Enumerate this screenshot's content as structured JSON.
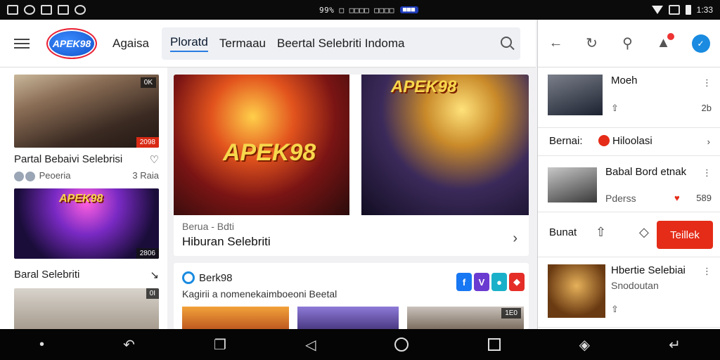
{
  "statusbar": {
    "mid_text": "99% □ □□□□ □□□□",
    "time": "1:33"
  },
  "appbar": {
    "logo_text": "APEK98",
    "home_label": "Agaisa",
    "tabs": [
      {
        "label": "Ploratd"
      },
      {
        "label": "Termaau"
      },
      {
        "label": "Beertal Selebriti Indoma"
      }
    ]
  },
  "leftcol": {
    "items": [
      {
        "badge": "0K",
        "duration": "2098",
        "title": "Partal Bebaivi Selebrisi",
        "author": "Peoeria",
        "stat": "3 Raia"
      },
      {
        "badge": "",
        "duration": "2806",
        "overlay": "APEK98",
        "title": "Baral Selebriti",
        "author": "",
        "stat": ""
      },
      {
        "badge": "0I",
        "duration": "",
        "title": "",
        "author": "",
        "stat": ""
      }
    ]
  },
  "feature": {
    "watermark_left": "APEK98",
    "watermark_right": "APEK98",
    "subtitle": "Berua - Bdti",
    "headline": "Hiburan Selebriti"
  },
  "card2": {
    "name": "Berk98",
    "description": "Kagirii a nomenekaimboeoni Beetal",
    "social": [
      "f",
      "V",
      "●",
      "◆"
    ],
    "badge": "1E0"
  },
  "rpanel": {
    "items": [
      {
        "title": "Moeh",
        "reaction": "",
        "stat": "2b"
      },
      {
        "label": "Bernai:",
        "link": "Hiloolasi"
      },
      {
        "title": "Babal Bord etnak",
        "sub": "Pderss",
        "count": "589"
      },
      {
        "share_label": "Bunat",
        "follow": "Teillek"
      },
      {
        "title": "Hbertie Selebiai",
        "sub": "Snodoutan"
      }
    ]
  },
  "colors": {
    "accent": "#e42c18",
    "blue": "#1a8be0"
  }
}
